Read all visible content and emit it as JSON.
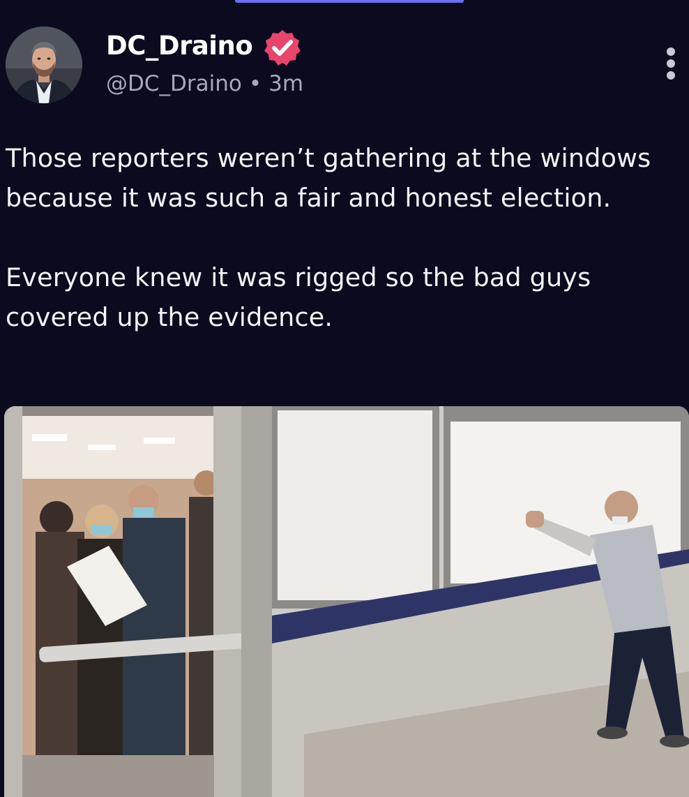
{
  "post": {
    "author": {
      "display_name": "DC_Draino",
      "handle": "@DC_Draino",
      "verified": true,
      "avatar": "avatar-man-photo"
    },
    "separator": "•",
    "time_ago": "3m",
    "text_paragraphs": [
      "Those reporters weren’t gathering at the windows because it was such a fair and honest election.",
      "Everyone knew it was rigged so the bad guys covered up the evidence."
    ],
    "more_icon": "vertical-ellipsis-icon",
    "media": {
      "type": "photo"
    }
  },
  "colors": {
    "background": "#0b0a1e",
    "text": "#f4f4f8",
    "muted": "#a8a8bd",
    "verified_badge": "#e8446c",
    "accent_bar": "#6b6ff0"
  }
}
